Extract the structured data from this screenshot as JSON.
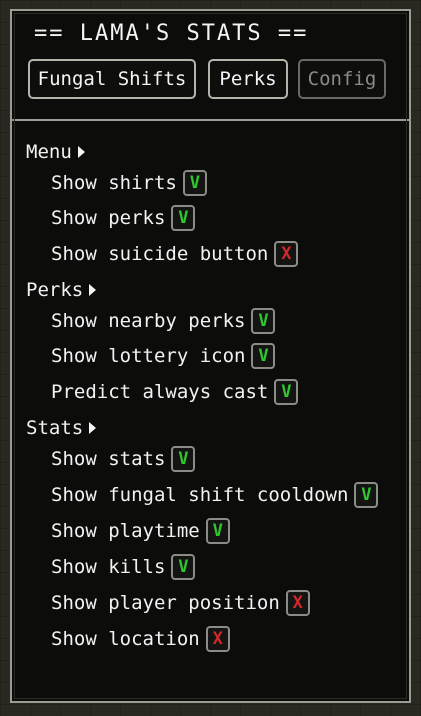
{
  "title": "== LAMA'S STATS ==",
  "tabs": [
    {
      "label": "Fungal Shifts",
      "enabled": true
    },
    {
      "label": "Perks",
      "enabled": true
    },
    {
      "label": "Config",
      "enabled": false
    }
  ],
  "sections": [
    {
      "label": "Menu",
      "options": [
        {
          "label": "Show shirts",
          "mark": "V",
          "checked": true
        },
        {
          "label": "Show perks",
          "mark": "V",
          "checked": true
        },
        {
          "label": "Show suicide button",
          "mark": "X",
          "checked": false
        }
      ]
    },
    {
      "label": "Perks",
      "options": [
        {
          "label": "Show nearby perks",
          "mark": "V",
          "checked": true
        },
        {
          "label": "Show lottery icon",
          "mark": "V",
          "checked": true
        },
        {
          "label": "Predict always cast",
          "mark": "V",
          "checked": true
        }
      ]
    },
    {
      "label": "Stats",
      "options": [
        {
          "label": "Show stats",
          "mark": "V",
          "checked": true
        },
        {
          "label": "Show fungal shift cooldown",
          "mark": "V",
          "checked": true
        },
        {
          "label": "Show playtime",
          "mark": "V",
          "checked": true
        },
        {
          "label": "Show kills",
          "mark": "V",
          "checked": true
        },
        {
          "label": "Show player position",
          "mark": "X",
          "checked": false
        },
        {
          "label": "Show location",
          "mark": "X",
          "checked": false
        }
      ]
    }
  ],
  "colors": {
    "checked": "#2ec82e",
    "unchecked": "#d22a2a",
    "panel": "#0c0c0b",
    "border": "#9c9c94"
  }
}
